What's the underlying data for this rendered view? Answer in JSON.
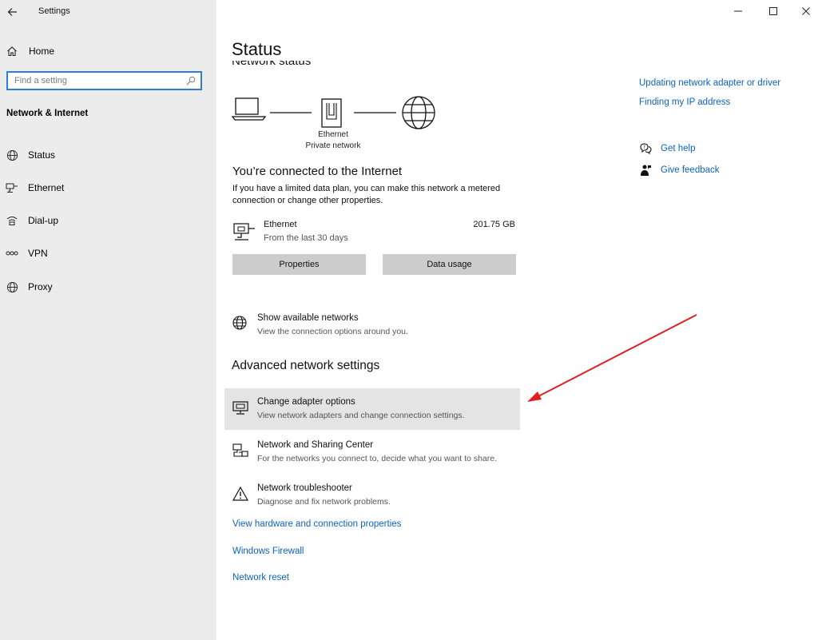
{
  "window": {
    "title": "Settings"
  },
  "sidebar": {
    "home_label": "Home",
    "search_placeholder": "Find a setting",
    "section_title": "Network & Internet",
    "items": [
      {
        "label": "Status",
        "icon": "globe-icon"
      },
      {
        "label": "Ethernet",
        "icon": "ethernet-icon"
      },
      {
        "label": "Dial-up",
        "icon": "dialup-icon"
      },
      {
        "label": "VPN",
        "icon": "vpn-icon"
      },
      {
        "label": "Proxy",
        "icon": "globe-icon"
      }
    ]
  },
  "main": {
    "title": "Status",
    "network_status_heading": "Network status",
    "diagram": {
      "adapter_label": "Ethernet",
      "network_label": "Private network"
    },
    "connection": {
      "title": "You’re connected to the Internet",
      "description": "If you have a limited data plan, you can make this network a metered connection or change other properties."
    },
    "adapter": {
      "name": "Ethernet",
      "period": "From the last 30 days",
      "data_used": "201.75 GB"
    },
    "buttons": {
      "properties": "Properties",
      "data_usage": "Data usage"
    },
    "show_networks": {
      "title": "Show available networks",
      "subtitle": "View the connection options around you."
    },
    "advanced_heading": "Advanced network settings",
    "advanced_items": [
      {
        "title": "Change adapter options",
        "subtitle": "View network adapters and change connection settings."
      },
      {
        "title": "Network and Sharing Center",
        "subtitle": "For the networks you connect to, decide what you want to share."
      },
      {
        "title": "Network troubleshooter",
        "subtitle": "Diagnose and fix network problems."
      }
    ],
    "links": {
      "hardware": "View hardware and connection properties",
      "firewall": "Windows Firewall",
      "reset": "Network reset"
    }
  },
  "right_panel": {
    "links": [
      "Updating network adapter or driver",
      "Finding my IP address"
    ],
    "get_help": "Get help",
    "give_feedback": "Give feedback"
  },
  "colors": {
    "accent": "#0b63c1",
    "sidebar_bg": "#ececec",
    "highlight": "#e4e4e4",
    "annotation_arrow": "#e02020"
  }
}
